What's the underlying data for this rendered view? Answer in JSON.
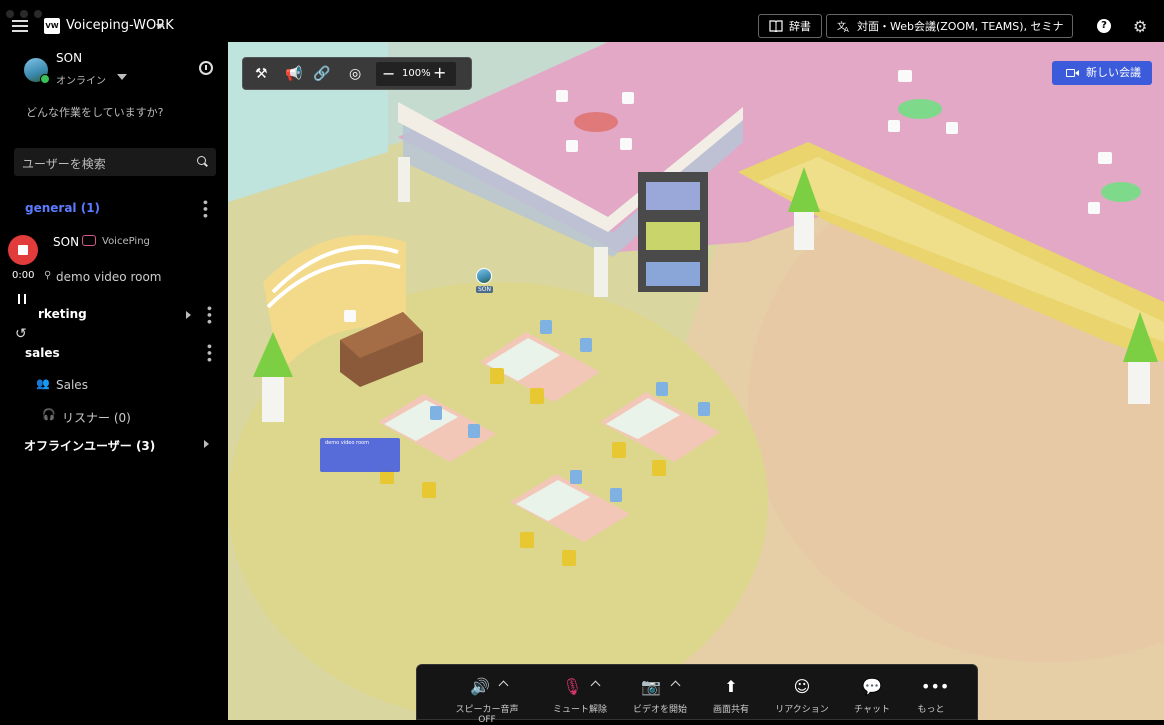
{
  "topbar": {
    "workspace_logo": "VW",
    "workspace_name": "Voiceping-WORK",
    "dictionary_label": "辞書",
    "translate_label": "対面・Web会議(ZOOM, TEAMS), セミナーの翻訳",
    "help_icon": "?",
    "settings_icon": "gear-icon"
  },
  "sidebar": {
    "user_name": "SON",
    "user_status": "オンライン",
    "activity_placeholder": "どんな作業をしていますか?",
    "search_placeholder": "ユーザーを検索",
    "general_label": "general (1)",
    "member_name": "SON",
    "member_app": "VoicePing",
    "room_label": "demo video room",
    "marketing_label": "rketing",
    "sales_label": "sales",
    "sales_group": "Sales",
    "listener_label": "リスナー (0)",
    "offline_label": "オフラインユーザー (3)",
    "recording_time": "0:00"
  },
  "map": {
    "zoom": "100%",
    "new_meeting": "新しい会議",
    "avatar_label": "SON",
    "room_card_title": "demo video room"
  },
  "controls": {
    "speaker": "スピーカー音声OFF",
    "mute": "ミュート解除",
    "video": "ビデオを開始",
    "screen": "画面共有",
    "reaction": "リアクション",
    "chat": "チャット",
    "more": "もっと"
  },
  "colors": {
    "accent": "#3b5bdb",
    "general_link": "#5b7cff",
    "record": "#e23b3b",
    "muted_red": "#d9366b"
  }
}
